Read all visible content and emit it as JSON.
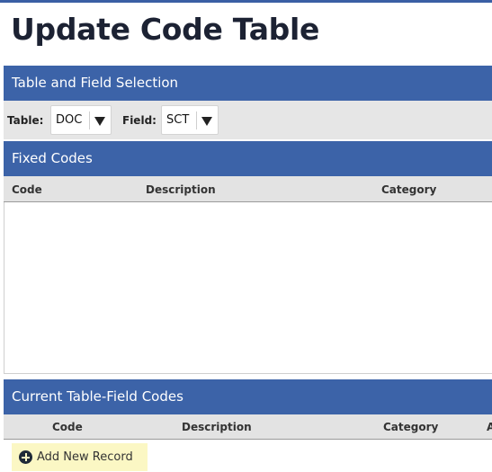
{
  "page": {
    "title": "Update Code Table"
  },
  "selection": {
    "header": "Table and Field Selection",
    "table_label": "Table:",
    "table_value": "DOC",
    "field_label": "Field:",
    "field_value": "SCT"
  },
  "fixed_codes": {
    "header": "Fixed Codes",
    "columns": [
      "Code",
      "Description",
      "Category"
    ],
    "rows": []
  },
  "current_codes": {
    "header": "Current Table-Field Codes",
    "columns": [
      "Code",
      "Description",
      "Category",
      "A"
    ],
    "rows": []
  },
  "actions": {
    "add_label": "Add New Record",
    "add_icon": "plus-circle-icon"
  }
}
